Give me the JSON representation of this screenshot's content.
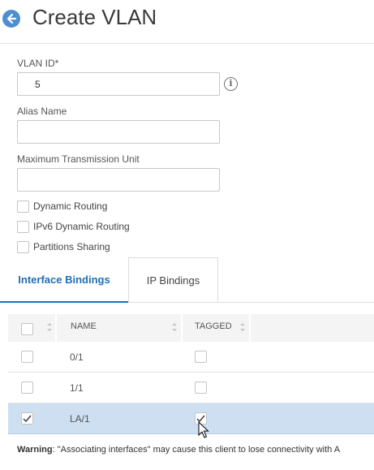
{
  "page": {
    "title": "Create VLAN"
  },
  "form": {
    "vlan_id": {
      "label": "VLAN ID*",
      "value": "5"
    },
    "alias_name": {
      "label": "Alias Name",
      "value": ""
    },
    "mtu": {
      "label": "Maximum Transmission Unit",
      "value": ""
    },
    "checkboxes": [
      {
        "label": "Dynamic Routing",
        "checked": false
      },
      {
        "label": "IPv6 Dynamic Routing",
        "checked": false
      },
      {
        "label": "Partitions Sharing",
        "checked": false
      }
    ]
  },
  "tabs": [
    {
      "label": "Interface Bindings",
      "active": true
    },
    {
      "label": "IP Bindings",
      "active": false
    }
  ],
  "table": {
    "columns": [
      "NAME",
      "TAGGED"
    ],
    "rows": [
      {
        "name": "0/1",
        "selected": false,
        "tagged": false
      },
      {
        "name": "1/1",
        "selected": false,
        "tagged": false
      },
      {
        "name": "LA/1",
        "selected": true,
        "tagged": true
      }
    ]
  },
  "warning": {
    "prefix": "Warning",
    "text": ": \"Associating interfaces\" may cause this client to lose connectivity with A"
  },
  "colors": {
    "accent": "#1f6fb2",
    "back_button": "#4e8fd1",
    "selected_row": "#cddff0"
  }
}
